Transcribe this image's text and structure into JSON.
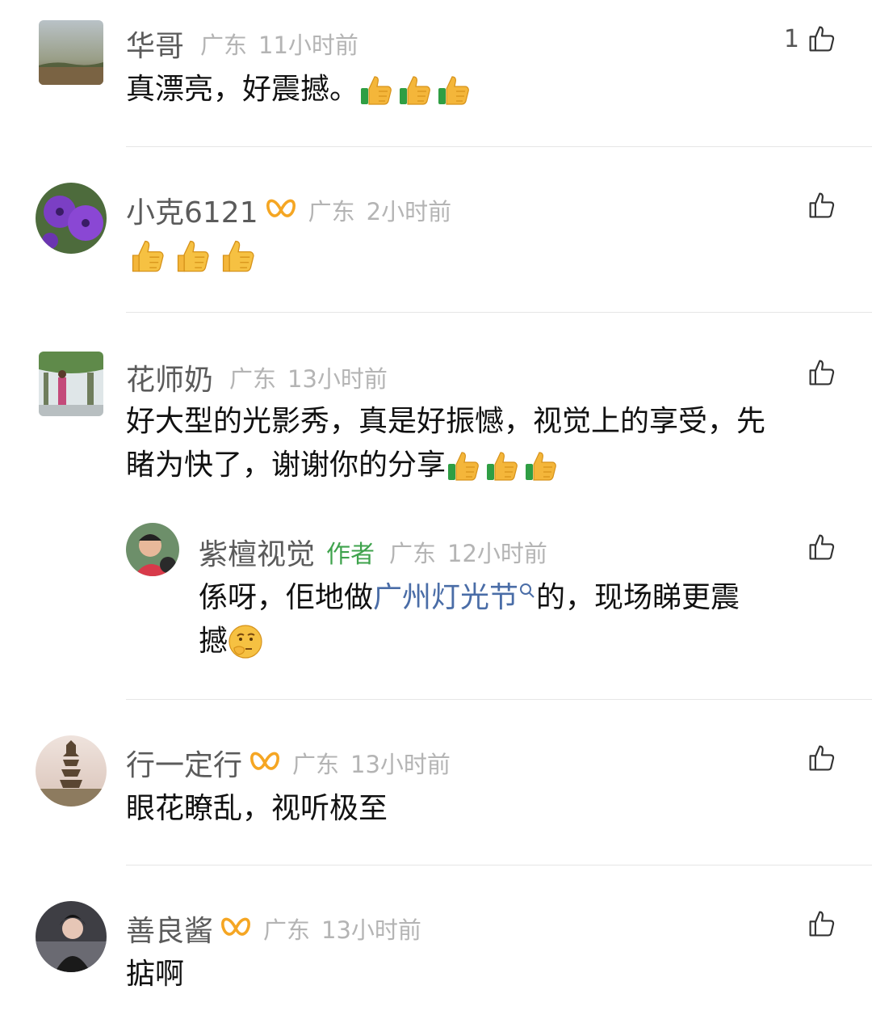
{
  "comments": [
    {
      "name": "华哥",
      "region": "广东",
      "time": "11小时前",
      "likes": "1",
      "text": "真漂亮，好震撼。"
    },
    {
      "name": "小克6121",
      "region": "广东",
      "time": "2小时前",
      "likes": "",
      "text": ""
    },
    {
      "name": "花师奶",
      "region": "广东",
      "time": "13小时前",
      "likes": "",
      "text_line1": "好大型的光影秀，真是好振憾，视觉上的享受，先",
      "text_line2": "睹为快了，谢谢你的分享"
    },
    {
      "name": "紫檀视觉",
      "author_tag": "作者",
      "region": "广东",
      "time": "12小时前",
      "likes": "",
      "text_pre": "係呀，佢地做",
      "text_link": "广州灯光节",
      "text_post": "的，现场睇更震",
      "text_line2": "撼"
    },
    {
      "name": "行一定行",
      "region": "广东",
      "time": "13小时前",
      "likes": "",
      "text": "眼花瞭乱，视听极至"
    },
    {
      "name": "善良酱",
      "region": "广东",
      "time": "13小时前",
      "likes": "",
      "text": "掂啊"
    }
  ],
  "colors": {
    "badge": "#f5a623",
    "link": "#4a6da7",
    "author_tag": "#3fa34d"
  }
}
